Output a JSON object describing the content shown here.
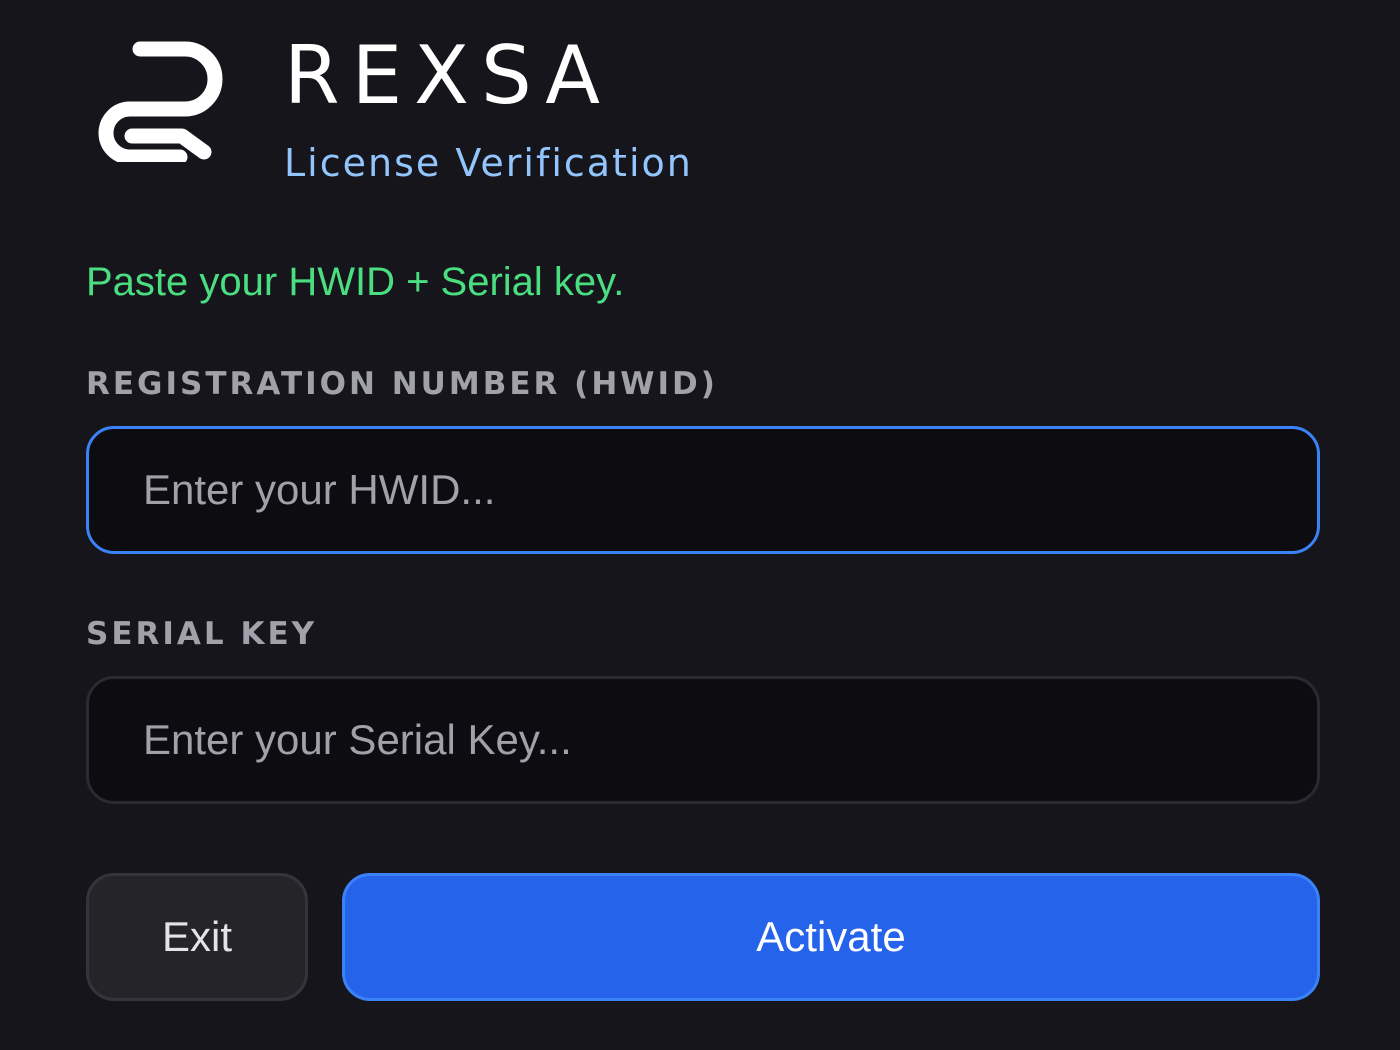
{
  "app": {
    "brand": "REXSA",
    "subtitle": "License Verification",
    "logo_icon": "rexsa-r-logo-icon"
  },
  "status": {
    "message": "Paste your HWID + Serial key.",
    "color": "#4ade80"
  },
  "form": {
    "hwid": {
      "label": "REGISTRATION NUMBER (HWID)",
      "value": "",
      "placeholder": "Enter your HWID..."
    },
    "serial": {
      "label": "SERIAL KEY",
      "value": "",
      "placeholder": "Enter your Serial Key..."
    }
  },
  "actions": {
    "exit_label": "Exit",
    "activate_label": "Activate",
    "accent_color": "#2563eb"
  }
}
